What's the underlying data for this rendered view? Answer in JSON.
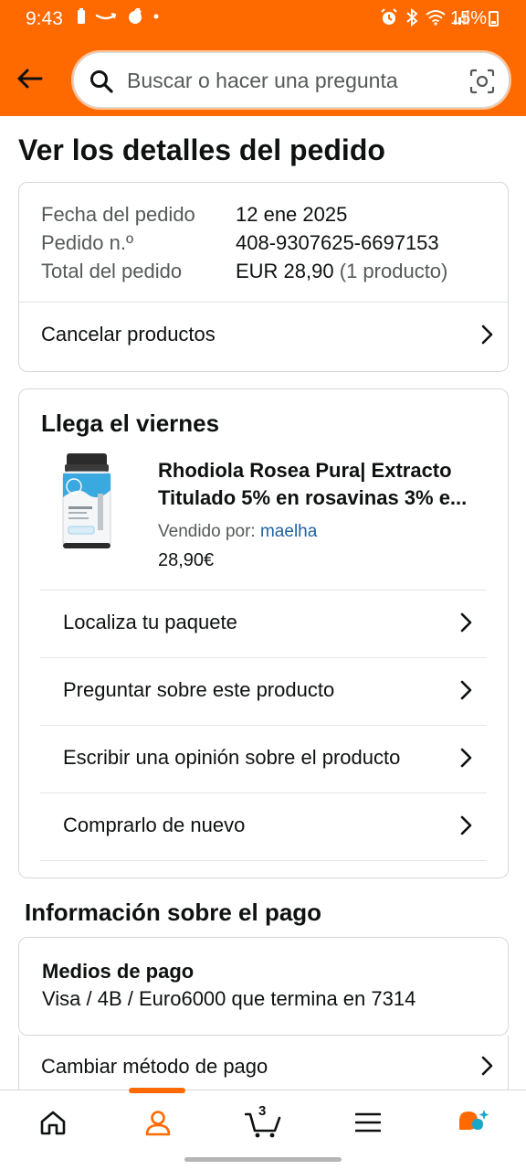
{
  "status_bar": {
    "time": "9:43",
    "battery": "15%"
  },
  "header": {
    "search_placeholder": "Buscar o hacer una pregunta"
  },
  "page_title": "Ver los detalles del pedido",
  "order_summary": {
    "date_label": "Fecha del pedido",
    "date_value": "12 ene 2025",
    "number_label": "Pedido n.º",
    "number_value": "408-9307625-6697153",
    "total_label": "Total del pedido",
    "total_value": "EUR 28,90",
    "total_count": "(1 producto)",
    "cancel_label": "Cancelar productos"
  },
  "delivery": {
    "title": "Llega el viernes",
    "product_title_line1": "Rhodiola Rosea Pura| Extracto",
    "product_title_line2": "Titulado 5% en rosavinas 3% e...",
    "seller_label": "Vendido por:",
    "seller_name": "maelha",
    "price": "28,90€",
    "actions": [
      {
        "label": "Localiza tu paquete"
      },
      {
        "label": "Preguntar sobre este producto"
      },
      {
        "label": "Escribir una opinión sobre el producto"
      },
      {
        "label": "Comprarlo de nuevo"
      }
    ]
  },
  "payment": {
    "section_title": "Información sobre el pago",
    "method_label": "Medios de pago",
    "method_value": "Visa / 4B / Euro6000  que termina en 7314",
    "change_label": "Cambiar método de pago"
  },
  "bottom_nav": {
    "cart_count": "3",
    "active_item": "account",
    "accent_color": "#ff6a00"
  }
}
